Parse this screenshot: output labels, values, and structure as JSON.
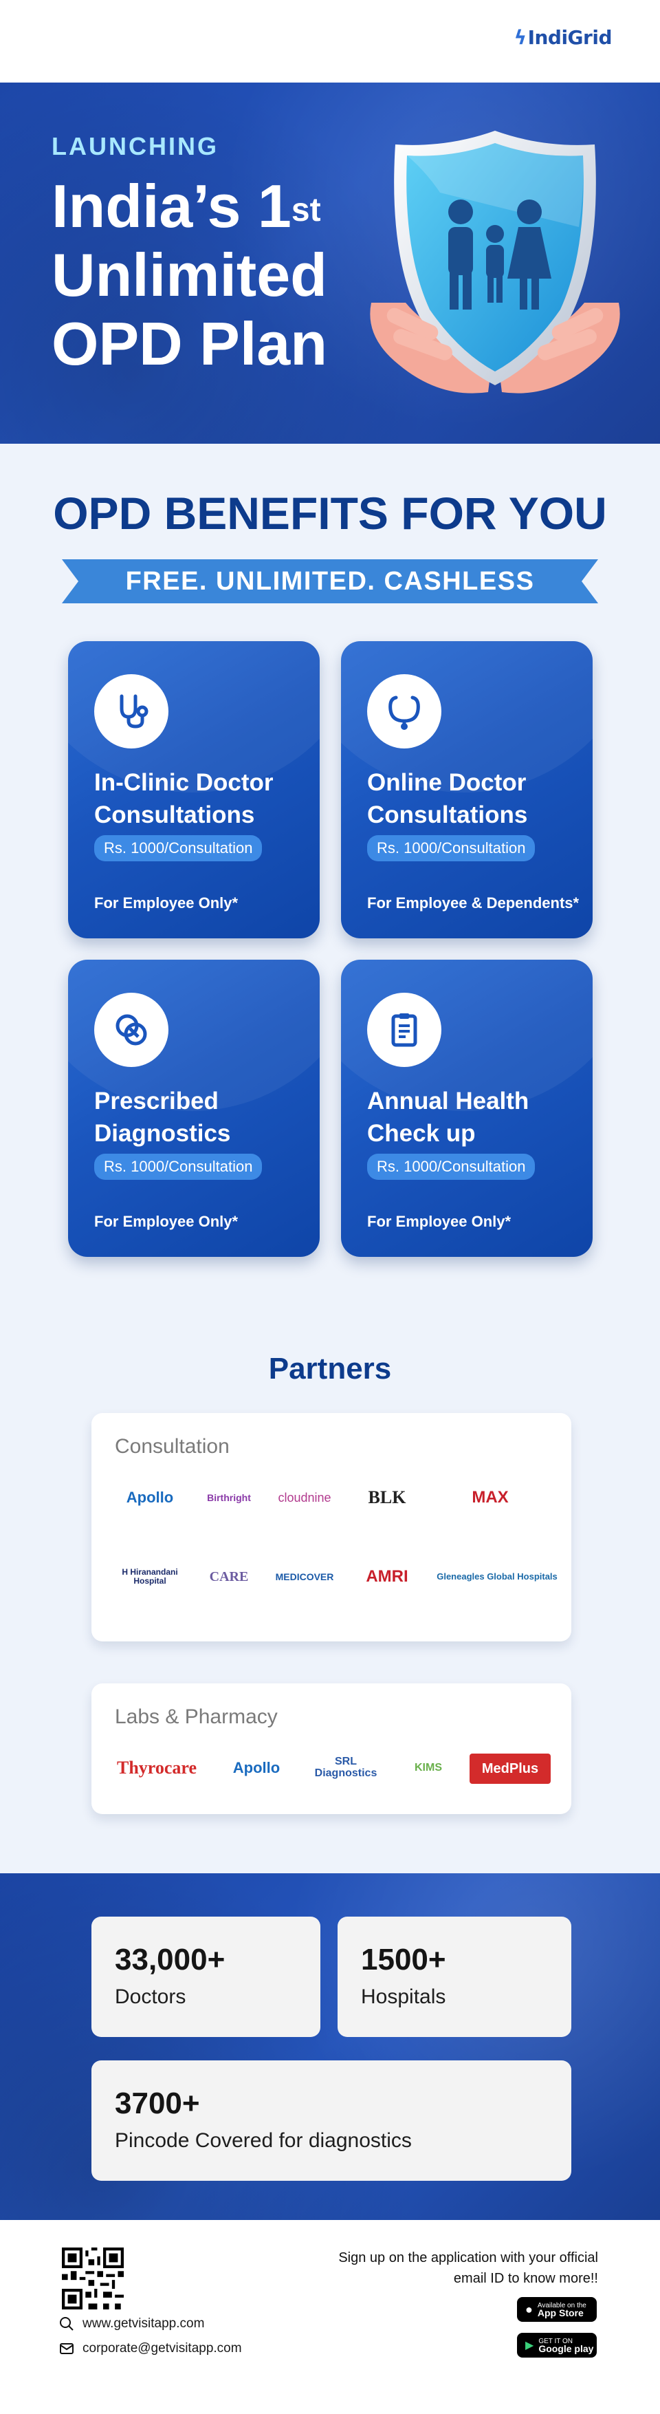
{
  "brand": {
    "logo_text": "IndiGrid"
  },
  "hero": {
    "tag": "LAUNCHING",
    "title_line1": "India’s 1",
    "title_sup": "st",
    "title_line2": "Unlimited",
    "title_line3": "OPD Plan"
  },
  "benefits": {
    "title": "OPD BENEFITS FOR YOU",
    "ribbon": "FREE. UNLIMITED. CASHLESS",
    "cards": [
      {
        "icon": "stethoscope-icon",
        "title": "In-Clinic Doctor Consultations",
        "price": "Rs. 1000/Consultation",
        "note": "For Employee Only*"
      },
      {
        "icon": "stethoscope-icon",
        "title": "Online Doctor Consultations",
        "price": "Rs. 1000/Consultation",
        "note": "For Employee & Dependents*"
      },
      {
        "icon": "pill-icon",
        "title": "Prescribed Diagnostics",
        "price": "Rs. 1000/Consultation",
        "note": "For Employee Only*"
      },
      {
        "icon": "clipboard-icon",
        "title": "Annual Health Check up",
        "price": "Rs. 1000/Consultation",
        "note": "For Employee Only*"
      }
    ]
  },
  "partners": {
    "title": "Partners",
    "consultation": {
      "heading": "Consultation",
      "logos": [
        "Apollo",
        "Birthright",
        "cloudnine",
        "BLK",
        "MAX",
        "H Hiranandani Hospital",
        "CARE",
        "MEDICOVER",
        "AMRI",
        "Gleneagles Global Hospitals"
      ]
    },
    "labs": {
      "heading": "Labs & Pharmacy",
      "logos": [
        "Thyrocare",
        "Apollo",
        "SRL Diagnostics",
        "KIMS",
        "MedPlus"
      ]
    }
  },
  "stats": [
    {
      "number": "33,000+",
      "label": "Doctors"
    },
    {
      "number": "1500+",
      "label": "Hospitals"
    },
    {
      "number": "3700+",
      "label": "Pincode Covered for diagnostics"
    }
  ],
  "footer": {
    "website": "www.getvisitapp.com",
    "email": "corporate@getvisitapp.com",
    "signup_text": "Sign up on the application with your official email ID to know more!!",
    "app_store_small": "Available on the",
    "app_store": "App Store",
    "google_play_small": "GET IT ON",
    "google_play": "Google play"
  },
  "colors": {
    "primary_dark": "#0d3b8c",
    "card_blue": "#1a55bd",
    "ribbon": "#3a86d9",
    "medplus_red": "#d32b2b"
  }
}
